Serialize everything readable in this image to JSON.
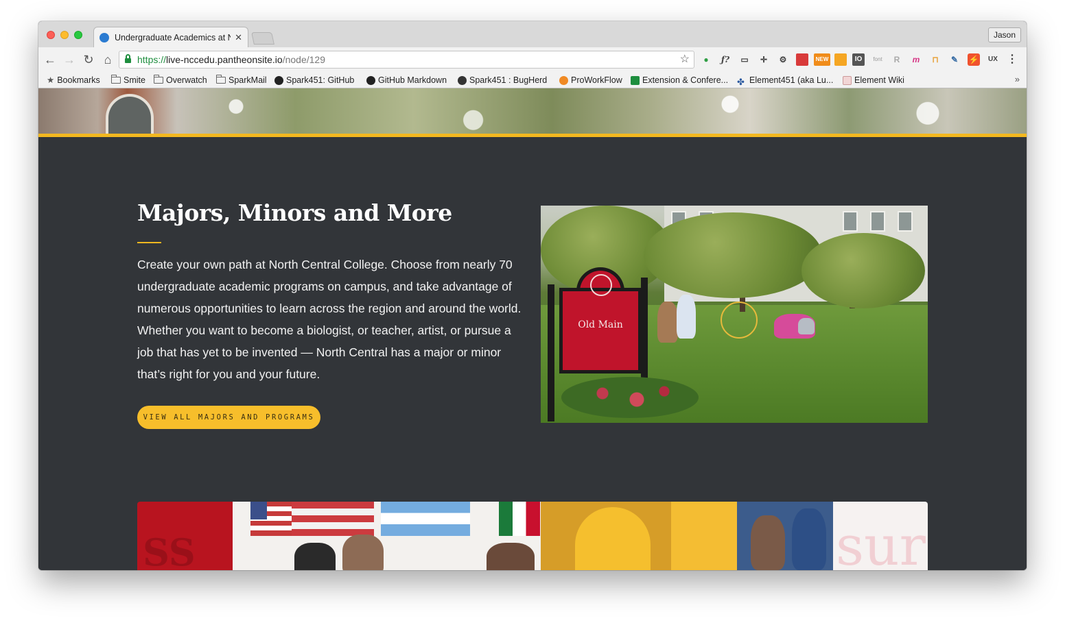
{
  "browser": {
    "tab_title": "Undergraduate Academics at North Central College",
    "tab_close": "✕",
    "profile_name": "Jason",
    "url": {
      "scheme": "https://",
      "host": "live-nccedu.pantheonsite.io",
      "path": "/node/129"
    },
    "nav": {
      "back": "←",
      "forward": "→",
      "reload": "↻",
      "home": "⌂",
      "star": "☆",
      "menu": "⋮"
    },
    "extensions": [
      "ƒ?",
      "⚙",
      "NEW",
      "IO",
      "font",
      "R",
      "m",
      "UX"
    ],
    "bookmarks": [
      {
        "label": "Bookmarks",
        "icon": "star-icon"
      },
      {
        "label": "Smite",
        "icon": "folder-icon"
      },
      {
        "label": "Overwatch",
        "icon": "folder-icon"
      },
      {
        "label": "SparkMail",
        "icon": "folder-icon"
      },
      {
        "label": "Spark451: GitHub",
        "icon": "github-icon"
      },
      {
        "label": "GitHub Markdown",
        "icon": "github-icon"
      },
      {
        "label": "Spark451 : BugHerd",
        "icon": "bugherd-icon"
      },
      {
        "label": "ProWorkFlow",
        "icon": "proworkflow-icon"
      },
      {
        "label": "Extension & Confere...",
        "icon": "sheets-icon"
      },
      {
        "label": "Element451 (aka Lu...",
        "icon": "element451-icon"
      },
      {
        "label": "Element Wiki",
        "icon": "wiki-icon"
      }
    ],
    "bookmarks_overflow": "»"
  },
  "page": {
    "section_title": "Majors, Minors and More",
    "section_body": "Create your own path at North Central College. Choose from nearly 70 undergraduate academic programs on campus, and take advantage of numerous opportunities to learn across the region and around the world. Whether you want to become a biologist, or teacher, artist, or pursue a job that has yet to be invented — North Central has a major or minor that’s right for you and your future.",
    "cta_label": "VIEW ALL MAJORS AND PROGRAMS",
    "photo_sign_text": "Old Main",
    "colors": {
      "accent": "#f3b820",
      "background": "#323539",
      "red": "#b8141f"
    }
  }
}
